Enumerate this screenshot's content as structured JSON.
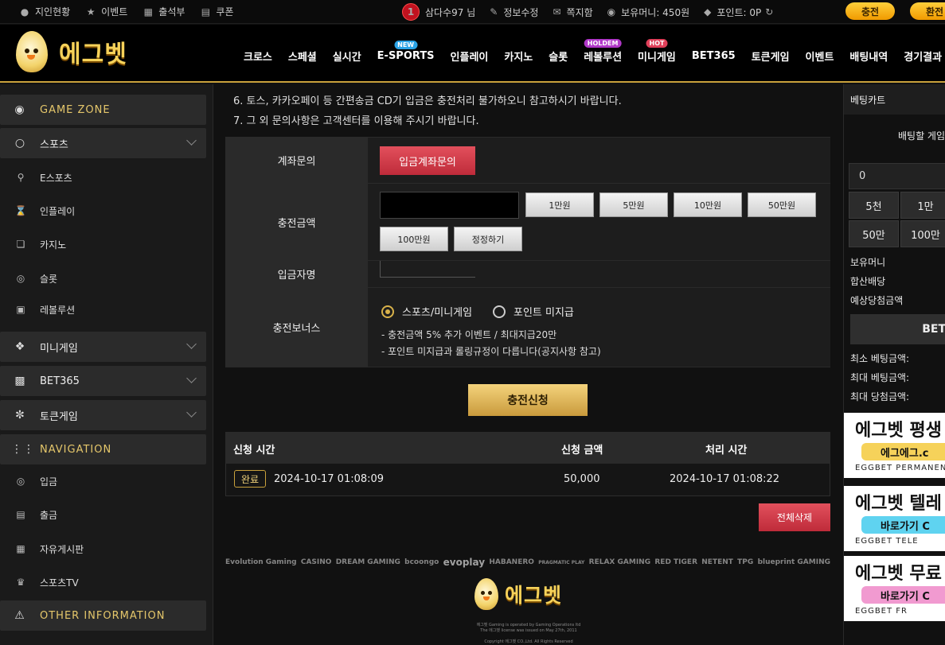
{
  "topbar": {
    "left": [
      {
        "icon": "person-icon",
        "label": "지인현황"
      },
      {
        "icon": "star-icon",
        "label": "이벤트"
      },
      {
        "icon": "calendar-icon",
        "label": "출석부"
      },
      {
        "icon": "coupon-icon",
        "label": "쿠폰"
      }
    ],
    "level": "1",
    "user": "삼다수97 님",
    "profile_edit": "정보수정",
    "messages": "쪽지함",
    "money": "보유머니: 450원",
    "points": "포인트: 0P",
    "charge": "충전",
    "exchange": "환전"
  },
  "header": {
    "logo": "에그벳",
    "nav": [
      {
        "label": "크로스",
        "badge": ""
      },
      {
        "label": "스페셜",
        "badge": ""
      },
      {
        "label": "실시간",
        "badge": ""
      },
      {
        "label": "E-SPORTS",
        "badge": "NEW"
      },
      {
        "label": "인플레이",
        "badge": ""
      },
      {
        "label": "카지노",
        "badge": ""
      },
      {
        "label": "슬롯",
        "badge": ""
      },
      {
        "label": "레볼루션",
        "badge": "HOLDEM"
      },
      {
        "label": "미니게임",
        "badge": "HOT"
      },
      {
        "label": "BET365",
        "badge": ""
      },
      {
        "label": "토큰게임",
        "badge": ""
      },
      {
        "label": "이벤트",
        "badge": ""
      },
      {
        "label": "배팅내역",
        "badge": ""
      },
      {
        "label": "경기결과",
        "badge": ""
      }
    ]
  },
  "sidebar": {
    "game_zone": "GAME ZONE",
    "sports": "스포츠",
    "sports_items": [
      "E스포츠",
      "인플레이",
      "카지노",
      "슬롯",
      "레볼루션"
    ],
    "mini": "미니게임",
    "bet365": "BET365",
    "token": "토큰게임",
    "navigation": "NAVIGATION",
    "nav_items": [
      "입금",
      "출금",
      "자유게시판",
      "스포츠TV"
    ],
    "other": "OTHER INFORMATION"
  },
  "main": {
    "notices": [
      "6. 토스, 카카오페이 등 간편송금 CD기 입금은 충전처리 불가하오니 참고하시기 바랍니다.",
      "7. 그 외 문의사항은 고객센터를 이용해 주시기 바랍니다."
    ],
    "form": {
      "account_label": "계좌문의",
      "account_btn": "입금계좌문의",
      "amount_label": "충전금액",
      "amount_btns": [
        "1만원",
        "5만원",
        "10만원",
        "50만원",
        "100만원",
        "정정하기"
      ],
      "name_label": "입금자명",
      "bonus_label": "충전보너스",
      "bonus_opt1": "스포츠/미니게임",
      "bonus_opt2": "포인트 미지급",
      "bonus_note1": "- 충전금액 5% 추가 이벤트 / 최대지급20만",
      "bonus_note2": "- 포인트 미지급과 롤링규정이 다릅니다(공지사항 참고)"
    },
    "submit": "충전신청",
    "history": {
      "headers": [
        "신청 시간",
        "신청 금액",
        "처리 시간"
      ],
      "rows": [
        {
          "status": "완료",
          "requested": "2024-10-17 01:08:09",
          "amount": "50,000",
          "processed": "2024-10-17 01:08:22"
        }
      ]
    },
    "delete_all": "전체삭제",
    "providers": [
      "Evolution Gaming",
      "CASINO",
      "DREAM GAMING",
      "bcoongo",
      "evoplay",
      "HABANERO",
      "PRAGMATIC PLAY",
      "RELAX GAMING",
      "RED TIGER",
      "NETENT",
      "TPG",
      "blueprint GAMING"
    ],
    "footer_logo": "에그벳",
    "fine1": "에그벳 Gaming is operated by Gaming Operations ltd",
    "fine2": "The 에그벳 license was issued on May 27th, 2011",
    "fine3": "Copyright 에그벳 CO.,Ltd. All Rights Reserved"
  },
  "cart": {
    "title": "베팅카트",
    "msg": "배팅할 게임",
    "amount": "0",
    "btns": [
      "5천",
      "1만",
      "50만",
      "100만"
    ],
    "holding": "보유머니",
    "combined": "합산배당",
    "expected": "예상당첨금액",
    "bet_btn": "BET",
    "min_bet": "최소 베팅금액:",
    "max_bet": "최대 베팅금액:",
    "max_win": "최대 당첨금액:"
  },
  "banners": [
    {
      "title": "에그벳 평생",
      "pill": "에그에그.c",
      "sub": "EGGBET PERMANEN",
      "color": "#f6d25a"
    },
    {
      "title": "에그벳 텔레",
      "pill": "바로가기 C",
      "sub": "EGGBET TELE",
      "color": "#5fd3f0"
    },
    {
      "title": "에그벳 무료",
      "pill": "바로가기 C",
      "sub": "EGGBET FR",
      "color": "#f19ad0"
    }
  ]
}
